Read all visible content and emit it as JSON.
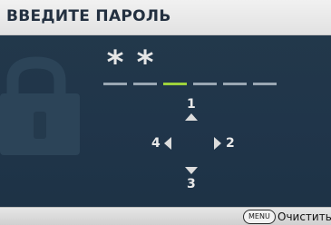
{
  "dialog": {
    "title": "ВВЕДИТЕ ПАРОЛЬ"
  },
  "password": {
    "slots": [
      "*",
      "*",
      "",
      "",
      "",
      ""
    ],
    "entered_count": 2,
    "active_index": 2
  },
  "keypad": {
    "up": "1",
    "right": "2",
    "down": "3",
    "left": "4"
  },
  "footer": {
    "menu_key": "MENU",
    "clear_label": "Очистить"
  },
  "colors": {
    "background": "#20354a",
    "title_bar": "#e6e6e6",
    "active_underline": "#9dd23c",
    "inactive_underline": "#9aa7b3"
  },
  "icons": {
    "watermark": "lock-icon",
    "up": "arrow-up-icon",
    "down": "arrow-down-icon",
    "left": "arrow-left-icon",
    "right": "arrow-right-icon"
  }
}
